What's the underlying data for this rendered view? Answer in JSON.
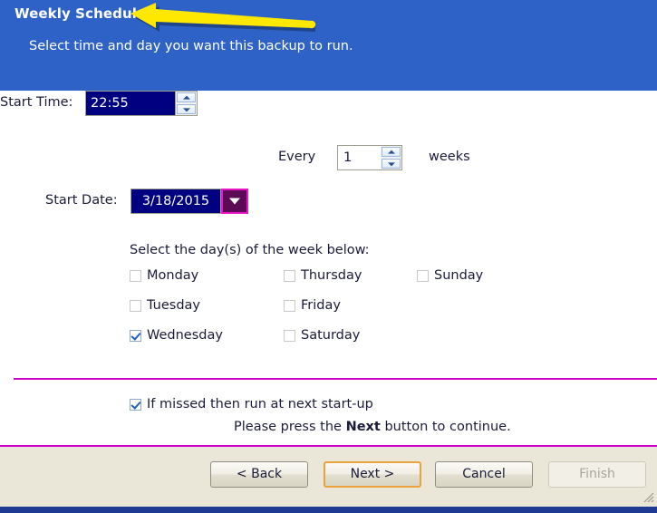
{
  "header": {
    "title": "Weekly Schedule",
    "subtitle": "Select time and day you want this backup to run.",
    "background_color": "#2f62c6",
    "annotation": {
      "type": "arrow",
      "color": "#ffe800",
      "direction": "left",
      "points_at": "Weekly Schedule"
    }
  },
  "form": {
    "start_time": {
      "label": "Start Time:",
      "value": "22:55",
      "spinner_up_icon": "chevron-up-icon",
      "spinner_down_icon": "chevron-down-icon"
    },
    "every": {
      "prefix_label": "Every",
      "value": "1",
      "suffix_label": "weeks"
    },
    "start_date": {
      "label": "Start Date:",
      "value": "3/18/2015",
      "dropdown_icon": "triangle-down-icon",
      "dropdown_color": "#5c0a56",
      "dropdown_border_color": "#e818c8"
    },
    "days": {
      "heading": "Select the day(s) of the week below:",
      "items": [
        {
          "label": "Monday",
          "checked": false,
          "col": 0,
          "row": 0
        },
        {
          "label": "Tuesday",
          "checked": false,
          "col": 0,
          "row": 1
        },
        {
          "label": "Wednesday",
          "checked": true,
          "col": 0,
          "row": 2
        },
        {
          "label": "Thursday",
          "checked": false,
          "col": 1,
          "row": 0
        },
        {
          "label": "Friday",
          "checked": false,
          "col": 1,
          "row": 1
        },
        {
          "label": "Saturday",
          "checked": false,
          "col": 1,
          "row": 2
        },
        {
          "label": "Sunday",
          "checked": false,
          "col": 2,
          "row": 0
        }
      ]
    },
    "missed": {
      "label": "If missed then run at next start-up",
      "checked": true
    },
    "instruction": {
      "before": "Please press the",
      "emphasis": "Next",
      "after": "button to continue."
    }
  },
  "separators": {
    "color": "#d100c8"
  },
  "footer": {
    "background_color": "#eae7d9",
    "buttons": [
      {
        "label": "< Back",
        "state": "enabled"
      },
      {
        "label": "Next >",
        "state": "focused"
      },
      {
        "label": "Cancel",
        "state": "enabled"
      },
      {
        "label": "Finish",
        "state": "disabled"
      }
    ],
    "resize_grip_icon": "resize-grip-icon",
    "bottom_strip_color": "#1f3a93"
  }
}
